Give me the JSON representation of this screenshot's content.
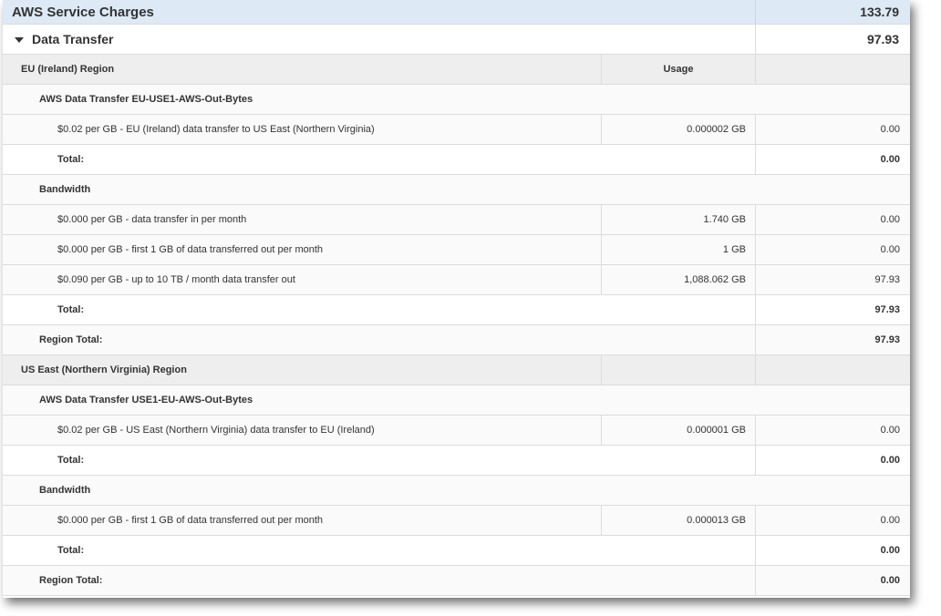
{
  "service": {
    "label": "AWS Service Charges",
    "amount": "133.79"
  },
  "category": {
    "label": "Data Transfer",
    "amount": "97.93"
  },
  "usage_header": "Usage",
  "regions": [
    {
      "name": "EU (Ireland) Region",
      "groups": [
        {
          "name": "AWS Data Transfer EU-USE1-AWS-Out-Bytes",
          "items": [
            {
              "description": "$0.02 per GB - EU (Ireland) data transfer to US East (Northern Virginia)",
              "usage": "0.000002 GB",
              "cost": "0.00"
            }
          ],
          "total_label": "Total:",
          "total": "0.00"
        },
        {
          "name": "Bandwidth",
          "items": [
            {
              "description": "$0.000 per GB - data transfer in per month",
              "usage": "1.740 GB",
              "cost": "0.00"
            },
            {
              "description": "$0.000 per GB - first 1 GB of data transferred out per month",
              "usage": "1 GB",
              "cost": "0.00"
            },
            {
              "description": "$0.090 per GB - up to 10 TB / month data transfer out",
              "usage": "1,088.062 GB",
              "cost": "97.93"
            }
          ],
          "total_label": "Total:",
          "total": "97.93"
        }
      ],
      "region_total_label": "Region Total:",
      "region_total": "97.93"
    },
    {
      "name": "US East (Northern Virginia) Region",
      "groups": [
        {
          "name": "AWS Data Transfer USE1-EU-AWS-Out-Bytes",
          "items": [
            {
              "description": "$0.02 per GB - US East (Northern Virginia) data transfer to EU (Ireland)",
              "usage": "0.000001 GB",
              "cost": "0.00"
            }
          ],
          "total_label": "Total:",
          "total": "0.00"
        },
        {
          "name": "Bandwidth",
          "items": [
            {
              "description": "$0.000 per GB - first 1 GB of data transferred out per month",
              "usage": "0.000013 GB",
              "cost": "0.00"
            }
          ],
          "total_label": "Total:",
          "total": "0.00"
        }
      ],
      "region_total_label": "Region Total:",
      "region_total": "0.00"
    }
  ]
}
